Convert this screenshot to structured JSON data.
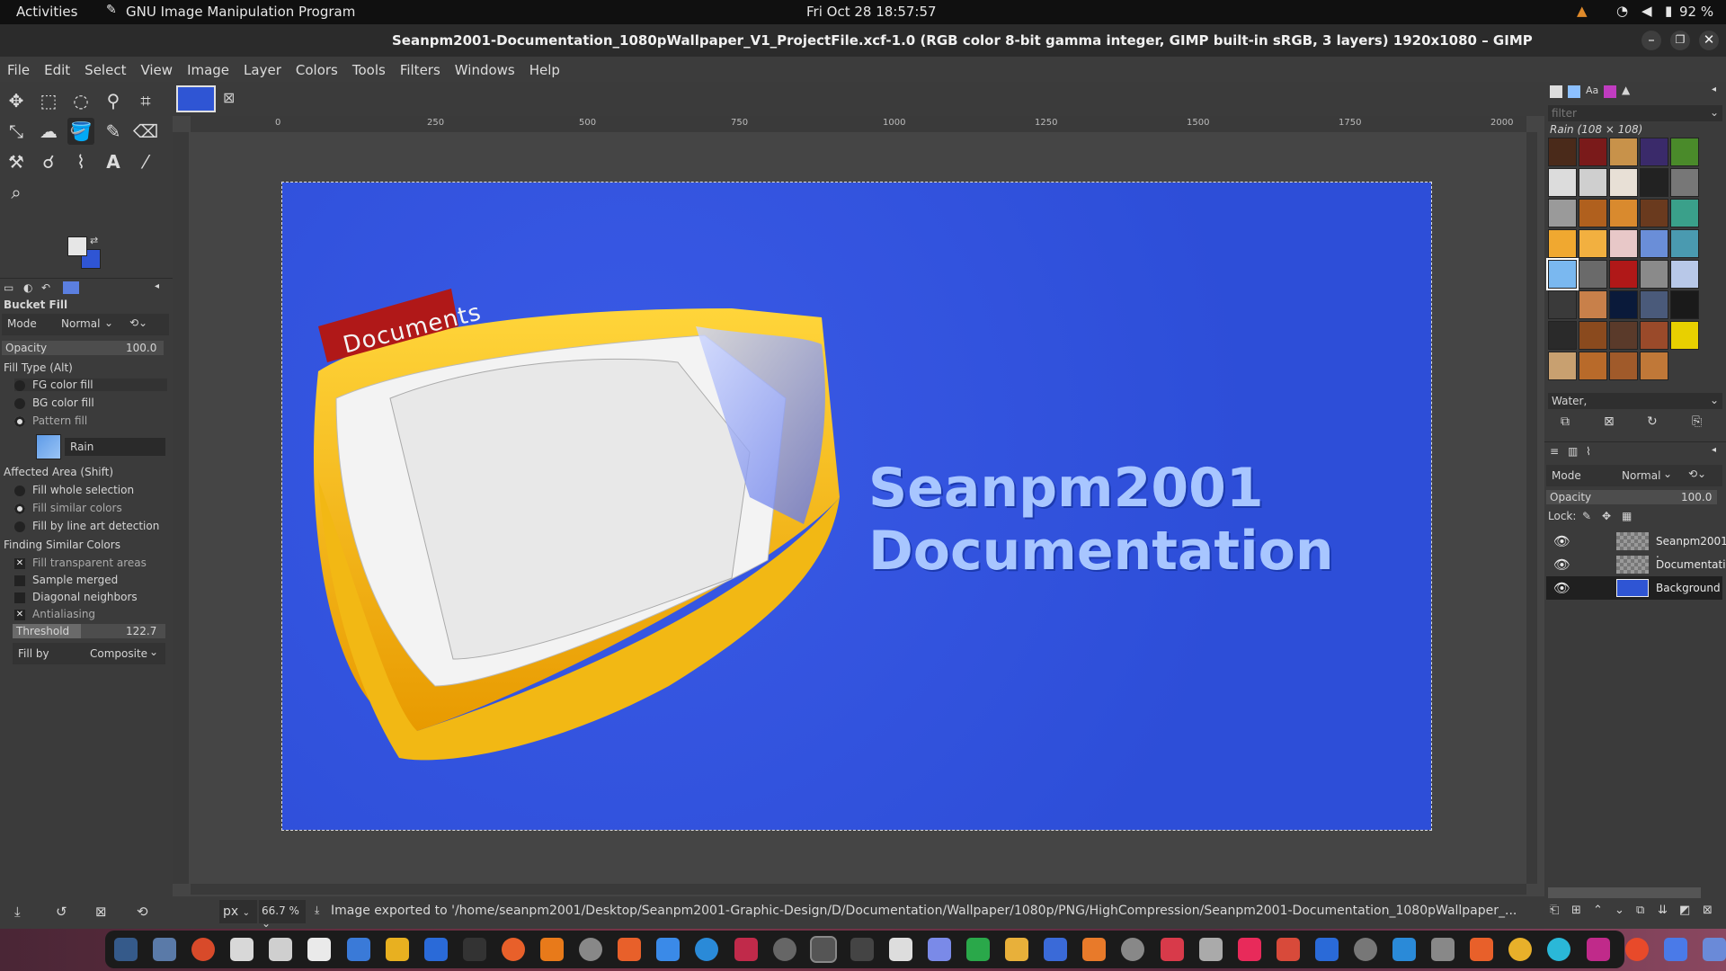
{
  "topbar": {
    "activities": "Activities",
    "app": "GNU Image Manipulation Program",
    "clock": "Fri Oct 28  18:57:57",
    "battery": "92 %"
  },
  "title": "Seanpm2001-Documentation_1080pWallpaper_V1_ProjectFile.xcf-1.0 (RGB color 8-bit gamma integer, GIMP built-in sRGB, 3 layers) 1920x1080 – GIMP",
  "menu": [
    "File",
    "Edit",
    "Select",
    "View",
    "Image",
    "Layer",
    "Colors",
    "Tools",
    "Filters",
    "Windows",
    "Help"
  ],
  "tool_options": {
    "title": "Bucket Fill",
    "mode_label": "Mode",
    "mode_value": "Normal",
    "opacity_label": "Opacity",
    "opacity_value": "100.0",
    "fill_type_label": "Fill Type  (Alt)",
    "fill_types": [
      "FG color fill",
      "BG color fill",
      "Pattern fill"
    ],
    "pattern_name": "Rain",
    "affected_label": "Affected Area  (Shift)",
    "affected": [
      "Fill whole selection",
      "Fill similar colors",
      "Fill by line art detection"
    ],
    "finding_label": "Finding Similar Colors",
    "finding": [
      "Fill transparent areas",
      "Sample merged",
      "Diagonal neighbors",
      "Antialiasing"
    ],
    "threshold_label": "Threshold",
    "threshold_value": "122.7",
    "fillby_label": "Fill by",
    "fillby_value": "Composite"
  },
  "ruler_labels": [
    "0",
    "250",
    "500",
    "750",
    "1000",
    "1250",
    "1500",
    "1750",
    "2000"
  ],
  "canvas": {
    "folder_tab": "Documents",
    "line1": "Seanpm2001",
    "line2": "Documentation",
    "bg_color": "#2e4fe0"
  },
  "patterns": {
    "filter_placeholder": "filter",
    "current": "Rain (108 × 108)",
    "tag": "Water,"
  },
  "layers_panel": {
    "mode_label": "Mode",
    "mode_value": "Normal",
    "opacity_label": "Opacity",
    "opacity_value": "100.0",
    "lock_label": "Lock:",
    "layers": [
      {
        "name": "Seanpm2001 ."
      },
      {
        "name": "Documentatio"
      },
      {
        "name": "Background"
      }
    ]
  },
  "status": {
    "unit": "px",
    "zoom": "66.7 %",
    "message": "Image exported to '/home/seanpm2001/Desktop/Seanpm2001-Graphic-Design/D/Documentation/Wallpaper/1080p/PNG/HighCompression/Seanpm2001-Documentation_1080pWallpaper_..."
  }
}
